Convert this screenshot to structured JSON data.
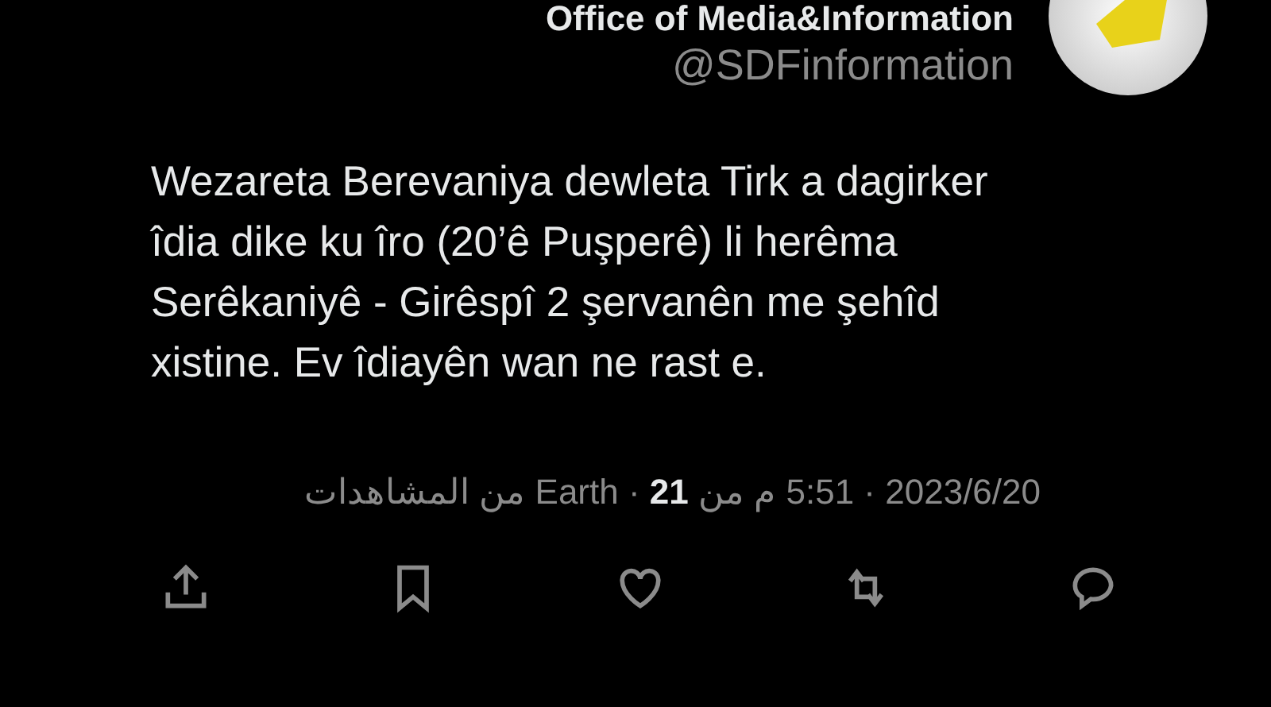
{
  "author": {
    "name": "Office of Media&Information",
    "handle": "@SDFinformation"
  },
  "body": {
    "lines": [
      "Wezareta Berevaniya dewleta Tirk a dagirker",
      "îdia dike ku îro (20’ê Puşperê) li herêma",
      "Serêkaniyê - Girêspî 2 şervanên me şehîd",
      "xistine. Ev îdiayên wan ne rast e."
    ]
  },
  "meta": "2023/6/20 · 5:51 م من Earth · **21** من المشاهدات",
  "actions": [
    {
      "kind": "share"
    },
    {
      "kind": "bookmark"
    },
    {
      "kind": "like"
    },
    {
      "kind": "retweet"
    },
    {
      "kind": "reply"
    }
  ]
}
